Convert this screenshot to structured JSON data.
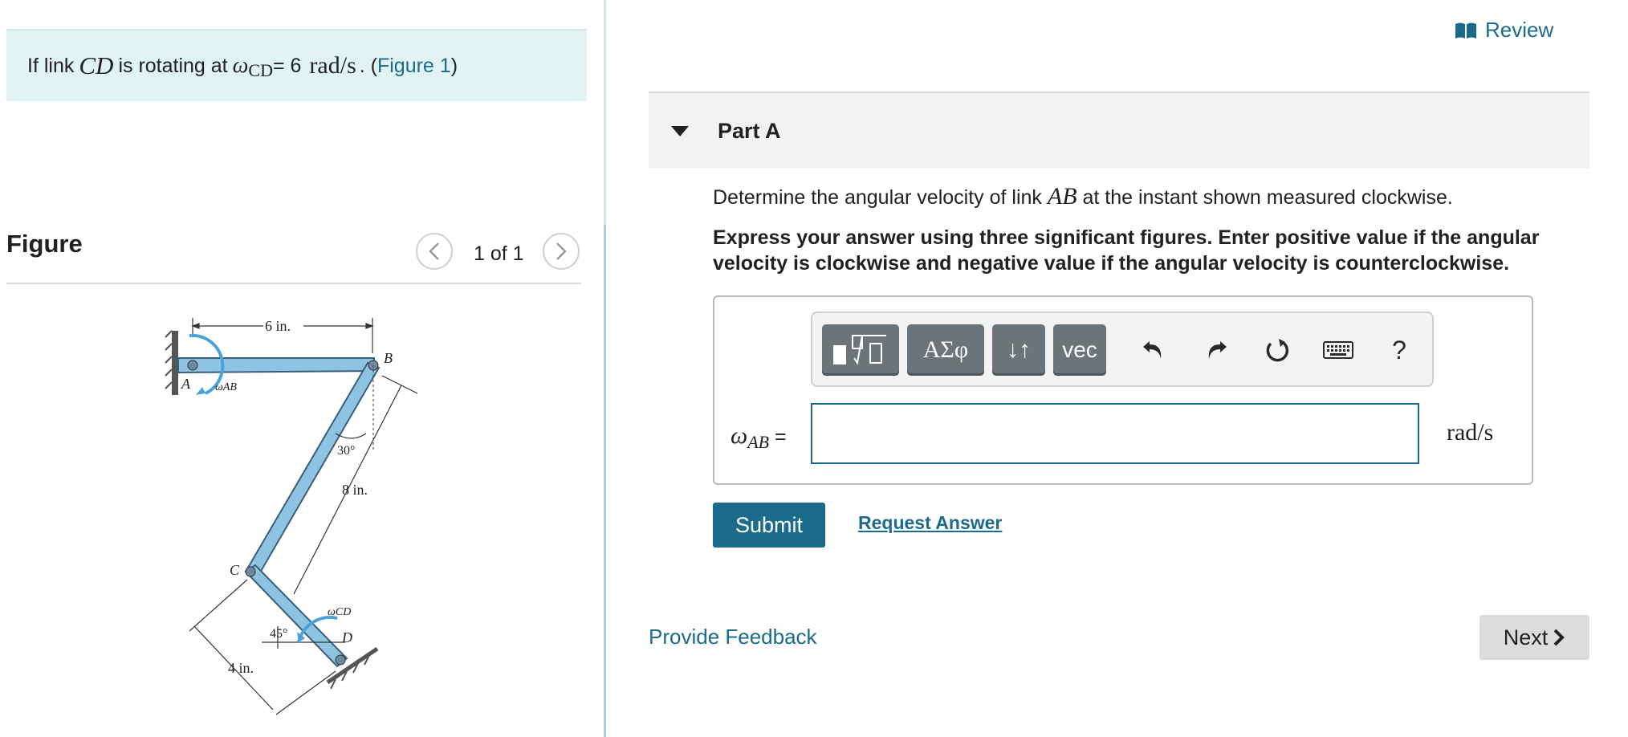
{
  "problem": {
    "prefix": "If link ",
    "link_name": "CD",
    "middle": " is rotating at ",
    "omega_symbol": "ω",
    "omega_subscript": "CD",
    "equals_value": " = 6",
    "unit": "rad/s",
    "dot": " . (",
    "figure_link": "Figure 1",
    "close": ")"
  },
  "figure": {
    "heading": "Figure",
    "pager_count": "1 of 1",
    "labels": {
      "dim_top": "6 in.",
      "point_a": "A",
      "omega_ab": "ωAB",
      "point_b": "B",
      "angle_30": "30°",
      "dim_8": "8 in.",
      "point_c": "C",
      "omega_cd": "ωCD",
      "point_d": "D",
      "angle_45": "45°",
      "dim_4": "4 in."
    }
  },
  "header": {
    "review_label": "Review"
  },
  "part": {
    "title": "Part A"
  },
  "question": {
    "prefix": "Determine the angular velocity of link ",
    "link_name": "AB",
    "suffix": " at the instant shown measured clockwise."
  },
  "instruction": "Express your answer using three significant figures. Enter positive value if the angular velocity is clockwise and negative value if the angular velocity is counterclockwise.",
  "toolbar": {
    "greek_label": "ΑΣφ",
    "arrows_label": "↓↑",
    "vec_label": "vec",
    "help_label": "?"
  },
  "answer": {
    "omega_symbol": "ω",
    "subscript": "AB",
    "equals": " =",
    "input_value": "",
    "unit": "rad/s"
  },
  "actions": {
    "submit_label": "Submit",
    "request_answer_label": "Request Answer"
  },
  "footer": {
    "feedback_label": "Provide Feedback",
    "next_label": "Next"
  },
  "colors": {
    "accent": "#1a6b8c",
    "problem_bg": "#e1f3f3",
    "link_fill": "#8fc3e2",
    "toolbar_button": "#6b7479"
  }
}
